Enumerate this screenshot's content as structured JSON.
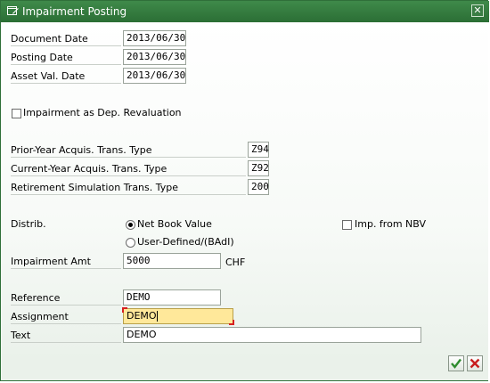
{
  "window": {
    "title": "Impairment Posting"
  },
  "dates": {
    "document_date": {
      "label": "Document Date",
      "value": "2013/06/30"
    },
    "posting_date": {
      "label": "Posting Date",
      "value": "2013/06/30"
    },
    "asset_val_date": {
      "label": "Asset Val. Date",
      "value": "2013/06/30"
    }
  },
  "impairment_dep_reval": {
    "label": "Impairment as Dep. Revaluation",
    "checked": false
  },
  "trans_types": {
    "prior_year": {
      "label": "Prior-Year Acquis. Trans. Type",
      "value": "Z94"
    },
    "current_year": {
      "label": "Current-Year Acquis. Trans. Type",
      "value": "Z92"
    },
    "retirement_sim": {
      "label": "Retirement Simulation Trans. Type",
      "value": "200"
    }
  },
  "distrib": {
    "label": "Distrib.",
    "options": [
      {
        "label": "Net Book Value",
        "selected": true
      },
      {
        "label": "User-Defined/(BAdI)",
        "selected": false
      }
    ],
    "imp_from_nbv": {
      "label": "Imp. from NBV",
      "checked": false
    }
  },
  "impairment_amt": {
    "label": "Impairment Amt",
    "value": "5000",
    "currency": "CHF"
  },
  "reference": {
    "label": "Reference",
    "value": "DEMO"
  },
  "assignment": {
    "label": "Assignment",
    "value": "DEMO"
  },
  "text": {
    "label": "Text",
    "value": "DEMO"
  },
  "icons": {
    "title": "edit-window-icon",
    "close": "close-icon",
    "confirm": "checkmark-icon",
    "cancel": "cancel-icon"
  },
  "colors": {
    "titlebar": "#2b6e35",
    "active_field": "#ffe89a",
    "confirm": "#2e8b2e",
    "cancel": "#c81e1e"
  }
}
